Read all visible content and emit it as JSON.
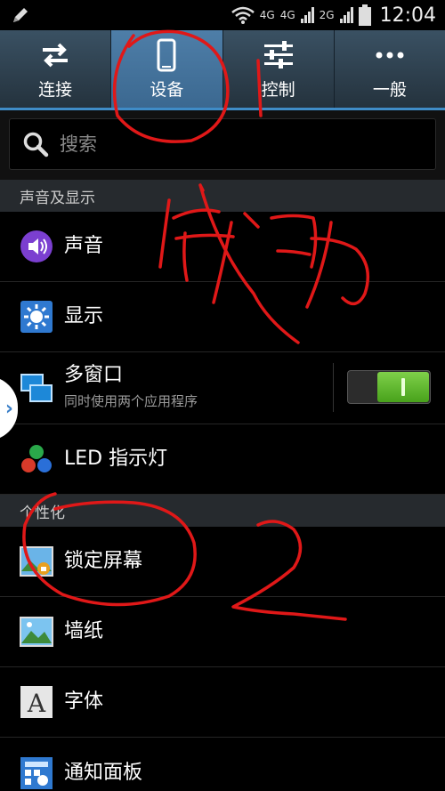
{
  "status_bar": {
    "network_1": "4G",
    "network_2": "4G",
    "network_3": "2G",
    "time": "12:04"
  },
  "tabs": [
    {
      "label": "连接",
      "icon": "swap-arrows-icon",
      "active": false
    },
    {
      "label": "设备",
      "icon": "phone-device-icon",
      "active": true
    },
    {
      "label": "控制",
      "icon": "sliders-icon",
      "active": false
    },
    {
      "label": "一般",
      "icon": "more-dots-icon",
      "active": false
    }
  ],
  "search": {
    "placeholder": "搜索"
  },
  "sections": [
    {
      "header": "声音及显示"
    },
    {
      "header": "个性化"
    }
  ],
  "rows": {
    "sound": {
      "title": "声音",
      "icon": "speaker-icon"
    },
    "display": {
      "title": "显示",
      "icon": "brightness-gear-icon"
    },
    "multiwindow": {
      "title": "多窗口",
      "subtitle": "同时使用两个应用程序",
      "icon": "multi-window-icon",
      "toggle_on": true
    },
    "led": {
      "title": "LED 指示灯",
      "icon": "led-dots-icon"
    },
    "lockscreen": {
      "title": "锁定屏幕",
      "icon": "lock-screen-icon"
    },
    "wallpaper": {
      "title": "墙纸",
      "icon": "wallpaper-icon"
    },
    "font": {
      "title": "字体",
      "icon": "font-a-icon"
    },
    "notification": {
      "title": "通知面板",
      "icon": "notification-panel-icon"
    }
  },
  "colors": {
    "accent_blue": "#3f8cc7",
    "toggle_green": "#5ab82a",
    "annotation_red": "#e01818"
  }
}
